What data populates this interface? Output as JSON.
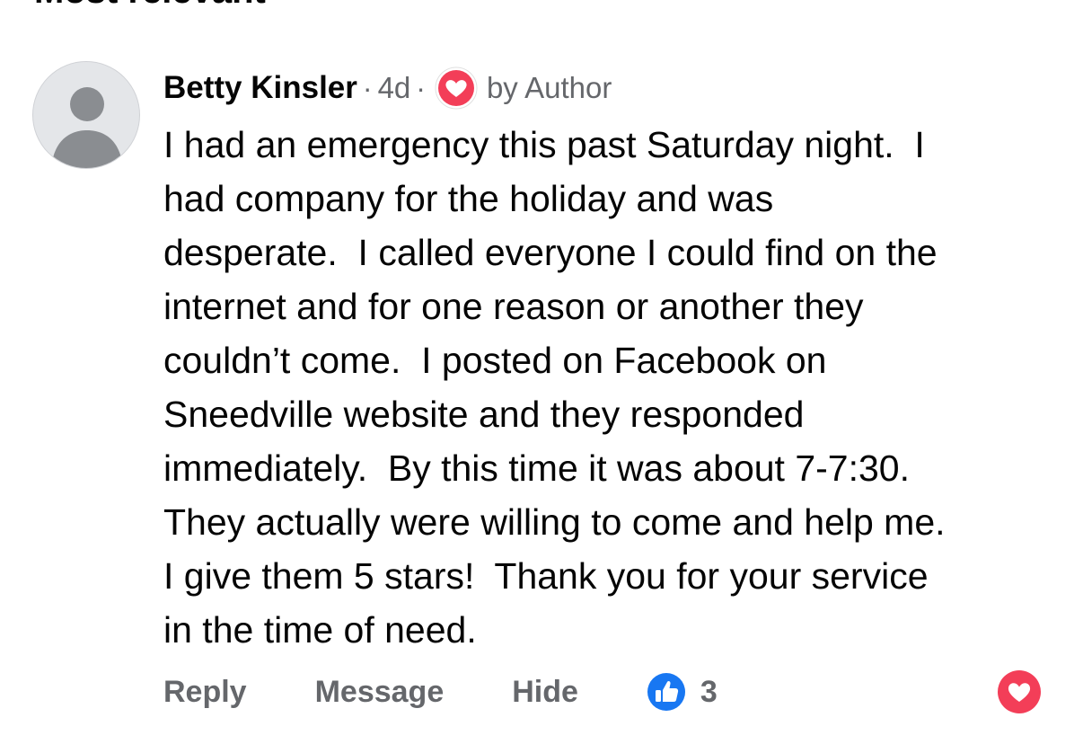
{
  "header": {
    "sort_label": "Most relevant"
  },
  "comment": {
    "author": "Betty Kinsler",
    "separator": "·",
    "time": "4d",
    "badge_icon": "heart-icon",
    "badge_text": "by Author",
    "body_lines": [
      "I had an emergency this past Saturday night.  I",
      "had company for the holiday and was",
      "desperate.  I called everyone I could find on the",
      "internet and for one reason or another they",
      "couldn’t come.  I posted on Facebook on",
      "Sneedville website and they responded",
      "immediately.  By this time it was about 7-7:30.",
      "They actually were willing to come and help me.",
      "I give them 5 stars!  Thank you for your service",
      "in the time of need."
    ]
  },
  "actions": {
    "reply": "Reply",
    "message": "Message",
    "hide": "Hide",
    "like_icon": "thumbs-up-icon",
    "like_count": "3",
    "react_icon": "heart-icon"
  },
  "colors": {
    "secondary_text": "#65676b",
    "primary_text": "#050505",
    "like_blue": "#1877f2",
    "heart_red": "#f33e58"
  }
}
